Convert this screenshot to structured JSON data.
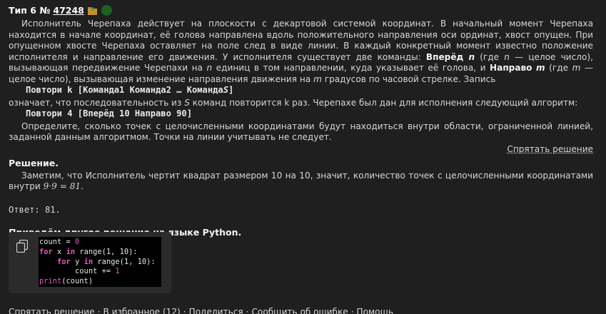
{
  "header": {
    "type_label": "Тип 6 №",
    "task_number": "47248"
  },
  "problem": {
    "p1": "Исполнитель Черепаха действует на плоскости с декартовой системой координат. В начальный момент Черепаха находится в начале координат, её голова направлена вдоль положительного направления оси ординат, хвост опущен. При опущенном хвосте Черепаха оставляет на поле след в виде линии. В каждый конкретный момент известно положение исполнителя и направление его движения. У исполнителя существует две команды:",
    "cmd_forward": "Вперёд",
    "var_n": "n",
    "p1b": "(где",
    "p1c": "— целое число), вызывающая передвижение Черепахи на",
    "p1d": "единиц в том направлении, куда указывает её голова, и",
    "cmd_right": "Направо",
    "var_m": "m",
    "p1e": "(где",
    "p1f": "— целое число), вызывающая изменение направления движения на",
    "p1g": "градусов по часовой стрелке. Запись",
    "repeat_syntax_a": "Повтори k [Команда1 Команда2 … Команда",
    "repeat_syntax_s": "S",
    "repeat_syntax_b": "]",
    "p2a": "означает, что последовательность из",
    "var_s": "S",
    "p2b": "команд повторится k раз. Черепахе был дан для исполнения следующий алгоритм:",
    "algorithm": "Повтори 4 [Вперёд 10 Направо 90]",
    "p3": "Определите, сколько точек с целочисленными координатами будут находиться внутри области, ограниченной линией, заданной данным алгоритмом. Точки на линии учитывать не следует."
  },
  "hide_solution_label": "Спрятать решение",
  "solution": {
    "title": "Решение.",
    "text_a": "Заметим, что Исполнитель чертит квадрат размером 10 на 10, значит, количество точек с целочисленными координатами внутри",
    "formula": "9·9 = 81.",
    "answer": "Ответ: 81.",
    "other_title": "Приведём другое решение на языке Python."
  },
  "code": {
    "l1_a": "count = ",
    "l1_num": "0",
    "l2_kw1": "for",
    "l2_a": " x ",
    "l2_kw2": "in",
    "l2_b": " range(1, 10):",
    "l3_kw1": "for",
    "l3_a": " y ",
    "l3_kw2": "in",
    "l3_b": " range(1, 10):",
    "l4_a": "count += ",
    "l4_num": "1",
    "l5_bi": "print",
    "l5_a": "(count)"
  },
  "footer": {
    "hide": "Спрятать решение",
    "favorites": "В избранное (12)",
    "share": "Поделиться",
    "report": "Сообщить об ошибке",
    "help": "Помощь",
    "sep": "·"
  },
  "colors": {
    "background": "#1e1f1e",
    "code_bg": "#000000",
    "keyword": "#e05cc6",
    "status_circle": "#1f5f1f"
  }
}
